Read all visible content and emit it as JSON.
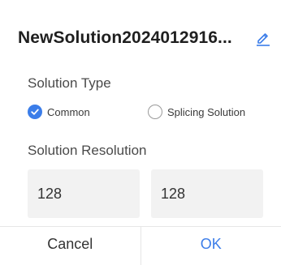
{
  "dialog": {
    "title": "NewSolution2024012916...",
    "edit_icon": "pencil-edit-icon"
  },
  "solution_type": {
    "label": "Solution Type",
    "options": [
      {
        "label": "Common",
        "checked": true
      },
      {
        "label": "Splicing Solution",
        "checked": false
      }
    ]
  },
  "solution_resolution": {
    "label": "Solution Resolution",
    "width": "128",
    "height": "128"
  },
  "footer": {
    "cancel_label": "Cancel",
    "ok_label": "OK"
  },
  "colors": {
    "accent": "#3b7de9",
    "input_bg": "#f2f2f2"
  }
}
